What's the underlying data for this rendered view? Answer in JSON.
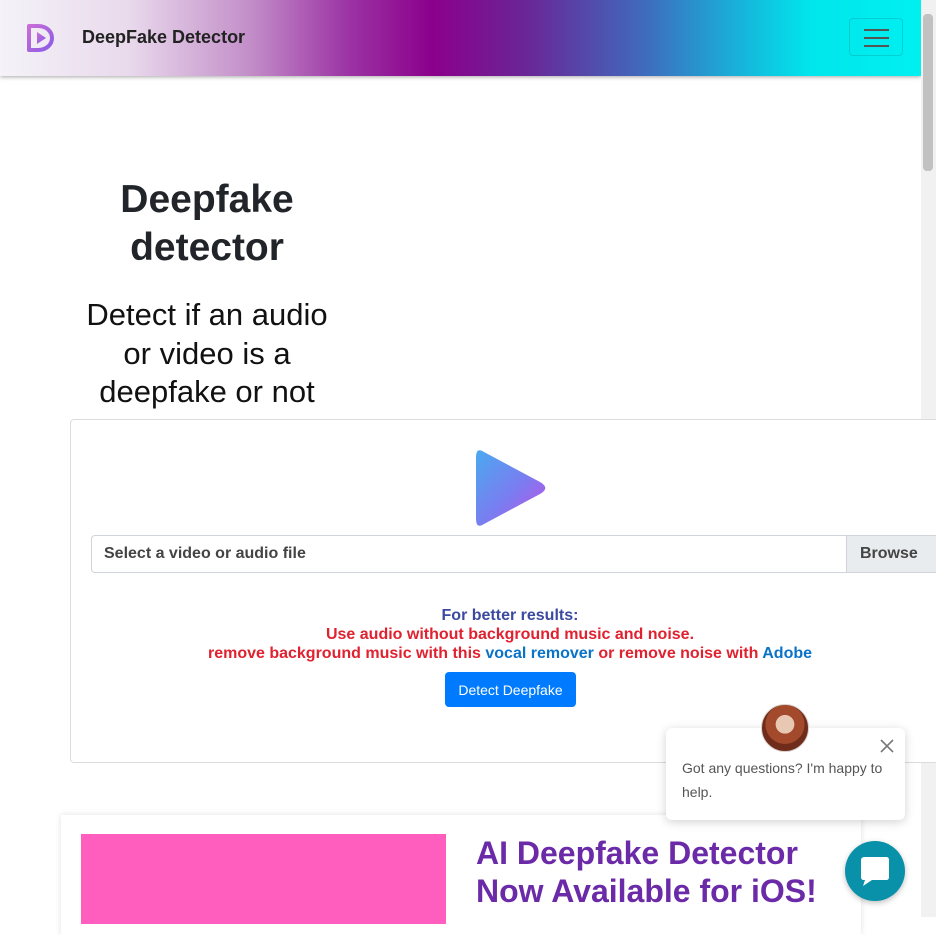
{
  "navbar": {
    "brand": "DeepFake Detector",
    "logo_icon": "deepfake-logo-icon",
    "menu_icon": "hamburger-menu-icon"
  },
  "hero": {
    "title": "Deepfake detector",
    "subtitle": "Detect if an audio or video is a deepfake or not"
  },
  "upload": {
    "icon": "play-icon",
    "file_label": "Select a video or audio file",
    "browse_label": "Browse"
  },
  "tips": {
    "heading": "For better results:",
    "line1": "Use audio without background music and noise.",
    "line2_prefix": "remove background music with this",
    "vocal_link": "vocal remover",
    "line2_middle": "or remove noise with",
    "adobe_link": "Adobe"
  },
  "detect_button": "Detect Deepfake",
  "chat": {
    "message": "Got any questions? I'm happy to help.",
    "close_icon": "close-icon",
    "launcher_icon": "chat-bubble-icon"
  },
  "promo": {
    "title": "AI Deepfake Detector Now Available for iOS!"
  },
  "colors": {
    "primary_button": "#007bff",
    "tip_heading": "#3b4aa0",
    "tip_warning": "#e0212f",
    "tip_link": "#0a73c8",
    "promo_title": "#6b2aa7",
    "promo_image": "#ff5ebf",
    "chat_launcher": "#0891a8"
  }
}
